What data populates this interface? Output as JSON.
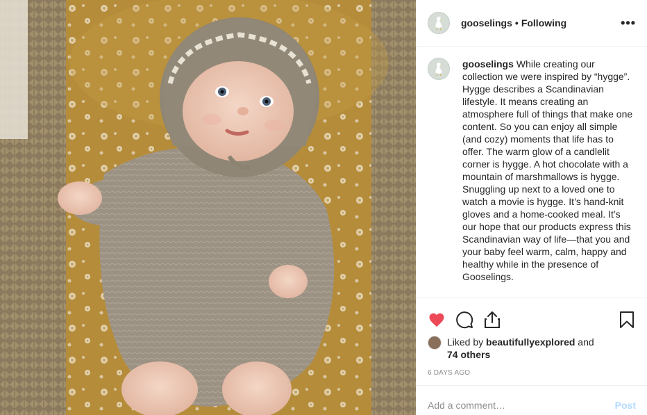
{
  "photo": {
    "alt_icon": "baby-photo"
  },
  "header": {
    "username": "gooselings",
    "separator": "•",
    "follow_status": "Following",
    "more_icon": "•••"
  },
  "caption": {
    "username": "gooselings",
    "text": "While creating our collection we were inspired by “hygge”. Hygge describes a Scandinavian lifestyle. It means creating an atmosphere full of things that make one content. So you can enjoy all simple (and cozy) moments that life has to offer. The warm glow of a candlelit corner is hygge. A hot chocolate with a mountain of marshmallows is hygge. Snuggling up next to a loved one to watch a movie is hygge. It’s hand-knit gloves and a home-cooked meal. It’s our hope that our products express this Scandinavian way of life—that you and your baby feel warm, calm, happy and healthy while in the presence of Gooselings."
  },
  "actions": {
    "like_icon": "heart-icon",
    "comment_icon": "comment-icon",
    "share_icon": "share-icon",
    "save_icon": "bookmark-icon",
    "like_color": "#ed4956"
  },
  "likes": {
    "prefix": "Liked by ",
    "user": "beautifullyexplored",
    "joiner": " and",
    "others": "74 others"
  },
  "timestamp": "6 DAYS AGO",
  "comment": {
    "placeholder": "Add a comment…",
    "post_label": "Post"
  }
}
